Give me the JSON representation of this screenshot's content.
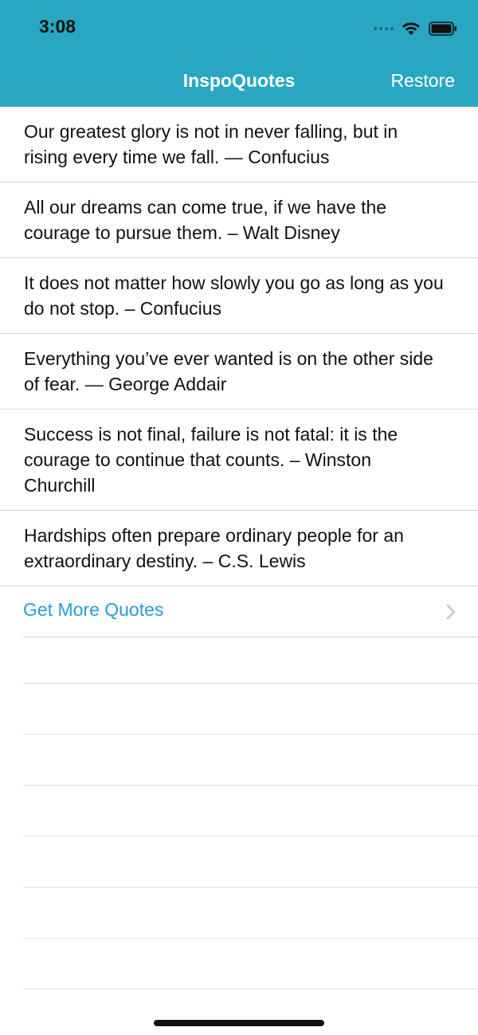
{
  "status_bar": {
    "time": "3:08"
  },
  "nav": {
    "title": "InspoQuotes",
    "restore_label": "Restore"
  },
  "quotes": [
    "Our greatest glory is not in never falling, but in rising every time we fall. — Confucius",
    "All our dreams can come true, if we have the courage to pursue them. – Walt Disney",
    "It does not matter how slowly you go as long as you do not stop. – Confucius",
    "Everything you’ve ever wanted is on the other side of fear. — George Addair",
    "Success is not final, failure is not fatal: it is the courage to continue that counts. – Winston Churchill",
    "Hardships often prepare ordinary people for an extraordinary destiny. – C.S. Lewis"
  ],
  "more": {
    "label": "Get More Quotes"
  },
  "colors": {
    "header": "#29a7c2",
    "link": "#2a9bdc"
  },
  "icons": {
    "wifi": "wifi-icon",
    "battery": "battery-icon",
    "chevron": "chevron-right-icon"
  }
}
